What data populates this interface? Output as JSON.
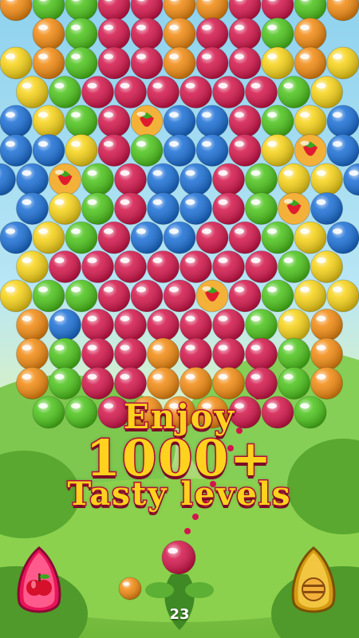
{
  "promo": {
    "line1": "Enjoy",
    "line2": "1000+",
    "line3": "Tasty levels"
  },
  "shots_remaining": "23",
  "colors": {
    "red": "#d4154a",
    "orange": "#f28a10",
    "yellow": "#f7d317",
    "green": "#4cc41a",
    "blue": "#1a6fd6",
    "promo_fill": "#ffd21e",
    "promo_outline": "#c4103e"
  },
  "board": {
    "rows": [
      "oggrroorrgo",
      "ogrrorrgo",
      "yogrrorryoy",
      "ygrrrrrrgy",
      "bygrSbbrgyb",
      "bbyrgbbryFb",
      "bbFgrbbrgyyb",
      "bygrbbrgFb",
      "bygrbbrrgyb",
      "yrrrrrrrgy",
      "yggrrrSrgyy",
      "obrrrrrgyo",
      "ogrrorrrgo",
      "ogrrooorgo",
      "ggrooorrg"
    ],
    "legend": "r=red o=orange y=yellow g=green b=blue S=strawberry F=strawberry"
  },
  "shooter": {
    "current_color": "red",
    "next_color": "orange"
  },
  "buttons": {
    "left_booster": "apple-booster",
    "right_booster": "striped-booster"
  }
}
